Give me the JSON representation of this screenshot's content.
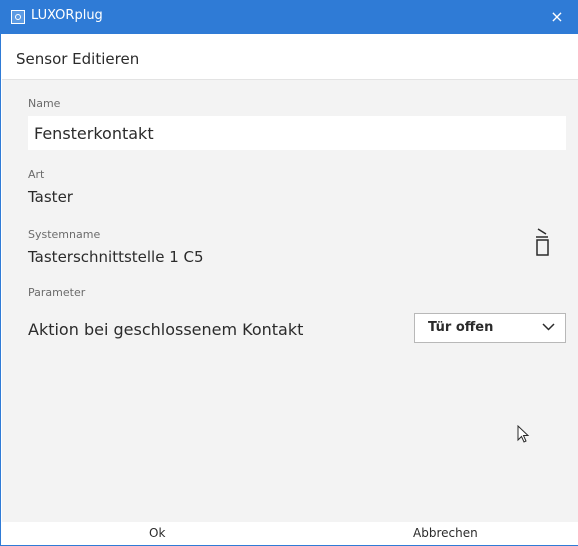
{
  "window": {
    "title": "LUXORplug",
    "app_icon": "luxorplug-app-icon",
    "close_icon": "×",
    "accent_color": "#2f7bd6"
  },
  "header": {
    "title": "Sensor Editieren"
  },
  "form": {
    "name": {
      "label": "Name",
      "value": "Fensterkontakt"
    },
    "art": {
      "label": "Art",
      "value": "Taster"
    },
    "systemname": {
      "label": "Systemname",
      "value": "Tasterschnittstelle 1 C5"
    },
    "parameter": {
      "label": "Parameter",
      "action_label": "Aktion bei geschlossenem Kontakt",
      "selected_option": "Tür offen"
    },
    "delete_icon": "trash-icon"
  },
  "footer": {
    "ok_label": "Ok",
    "cancel_label": "Abbrechen"
  }
}
